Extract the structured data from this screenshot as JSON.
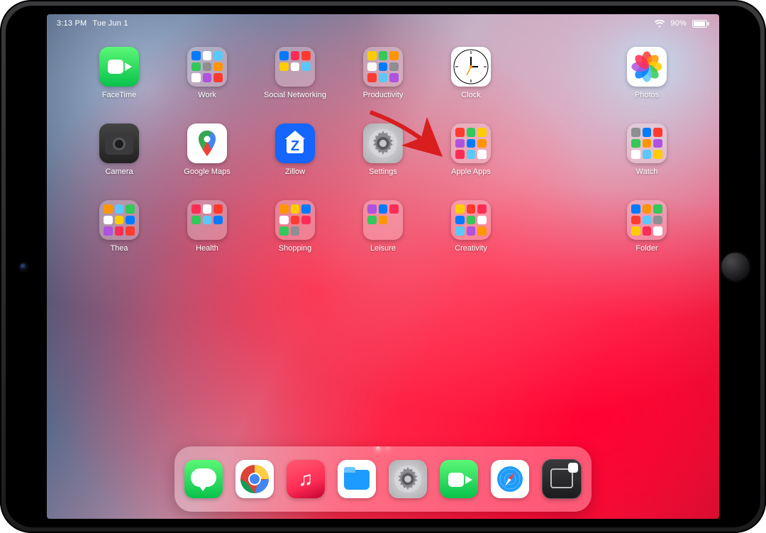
{
  "status": {
    "time": "3:13 PM",
    "date": "Tue Jun 1",
    "battery_pct": "90%",
    "wifi_icon": "wifi-icon",
    "battery_icon": "battery-icon"
  },
  "home": {
    "rows": [
      [
        {
          "id": "facetime",
          "label": "FaceTime",
          "kind": "app"
        },
        {
          "id": "work",
          "label": "Work",
          "kind": "folder"
        },
        {
          "id": "social",
          "label": "Social Networking",
          "kind": "folder"
        },
        {
          "id": "productivity",
          "label": "Productivity",
          "kind": "folder"
        },
        {
          "id": "clock",
          "label": "Clock",
          "kind": "app"
        },
        {
          "id": "_gap1",
          "label": "",
          "kind": "gap"
        },
        {
          "id": "photos",
          "label": "Photos",
          "kind": "app"
        }
      ],
      [
        {
          "id": "camera",
          "label": "Camera",
          "kind": "app"
        },
        {
          "id": "gmaps",
          "label": "Google Maps",
          "kind": "app"
        },
        {
          "id": "zillow",
          "label": "Zillow",
          "kind": "app"
        },
        {
          "id": "settings",
          "label": "Settings",
          "kind": "app"
        },
        {
          "id": "appleapps",
          "label": "Apple Apps",
          "kind": "folder"
        },
        {
          "id": "_gap2",
          "label": "",
          "kind": "gap"
        },
        {
          "id": "watch",
          "label": "Watch",
          "kind": "folder"
        }
      ],
      [
        {
          "id": "thea",
          "label": "Thea",
          "kind": "folder"
        },
        {
          "id": "health",
          "label": "Health",
          "kind": "folder"
        },
        {
          "id": "shopping",
          "label": "Shopping",
          "kind": "folder"
        },
        {
          "id": "leisure",
          "label": "Leisure",
          "kind": "folder"
        },
        {
          "id": "creativity",
          "label": "Creativity",
          "kind": "folder"
        },
        {
          "id": "_gap3",
          "label": "",
          "kind": "gap"
        },
        {
          "id": "folder",
          "label": "Folder",
          "kind": "folder"
        }
      ]
    ],
    "page_indicator": {
      "count": 2,
      "active": 0
    }
  },
  "dock": [
    {
      "id": "messages",
      "label": "Messages"
    },
    {
      "id": "chrome",
      "label": "Chrome"
    },
    {
      "id": "music",
      "label": "Music"
    },
    {
      "id": "files",
      "label": "Files"
    },
    {
      "id": "settings",
      "label": "Settings"
    },
    {
      "id": "facetime",
      "label": "FaceTime"
    },
    {
      "id": "safari",
      "label": "Safari"
    },
    {
      "id": "handoff",
      "label": "Handoff"
    }
  ],
  "annotation": {
    "target": "settings",
    "shape": "red-arrow"
  }
}
